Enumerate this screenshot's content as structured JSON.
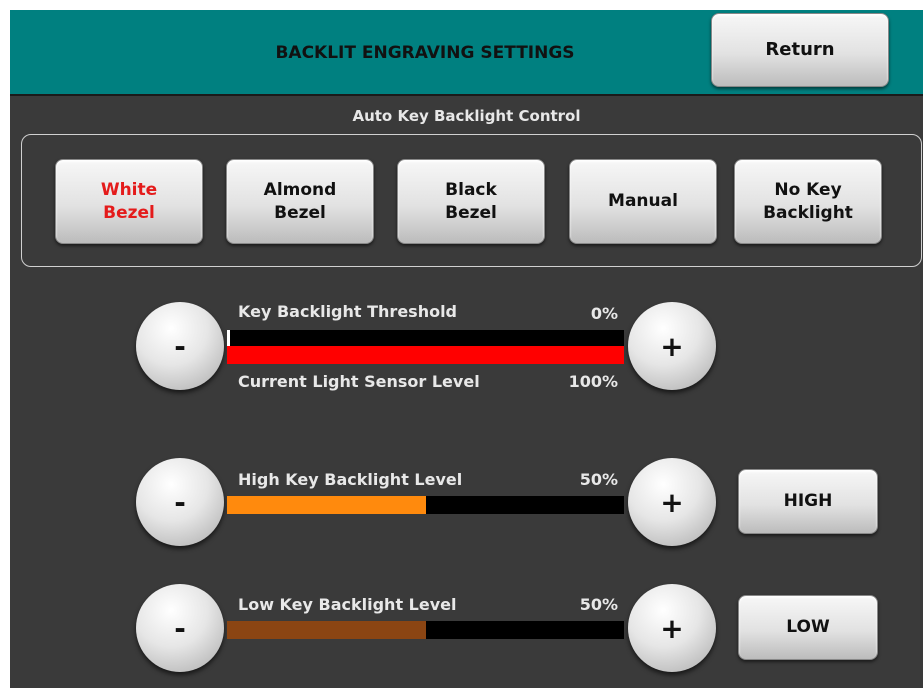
{
  "header": {
    "title": "BACKLIT ENGRAVING SETTINGS",
    "return_label": "Return"
  },
  "auto_control": {
    "label": "Auto Key Backlight Control",
    "buttons": [
      {
        "label": "White\nBezel",
        "selected": true
      },
      {
        "label": "Almond\nBezel",
        "selected": false
      },
      {
        "label": "Black\nBezel",
        "selected": false
      },
      {
        "label": "Manual",
        "selected": false
      },
      {
        "label": "No Key\nBacklight",
        "selected": false
      }
    ]
  },
  "threshold": {
    "label": "Key Backlight Threshold",
    "percent": "0%",
    "sensor_label": "Current Light Sensor Level",
    "sensor_percent": "100%",
    "threshold_fraction": 0.0,
    "sensor_fraction": 1.0,
    "fill_color": "#ff0000",
    "minus": "-",
    "plus": "+"
  },
  "high_level": {
    "label": "High Key Backlight Level",
    "percent": "50%",
    "fraction": 0.5,
    "fill_color": "#ff8a0d",
    "minus": "-",
    "plus": "+",
    "button_label": "HIGH"
  },
  "low_level": {
    "label": "Low Key Backlight Level",
    "percent": "50%",
    "fraction": 0.5,
    "fill_color": "#8b4513",
    "minus": "-",
    "plus": "+",
    "button_label": "LOW"
  }
}
